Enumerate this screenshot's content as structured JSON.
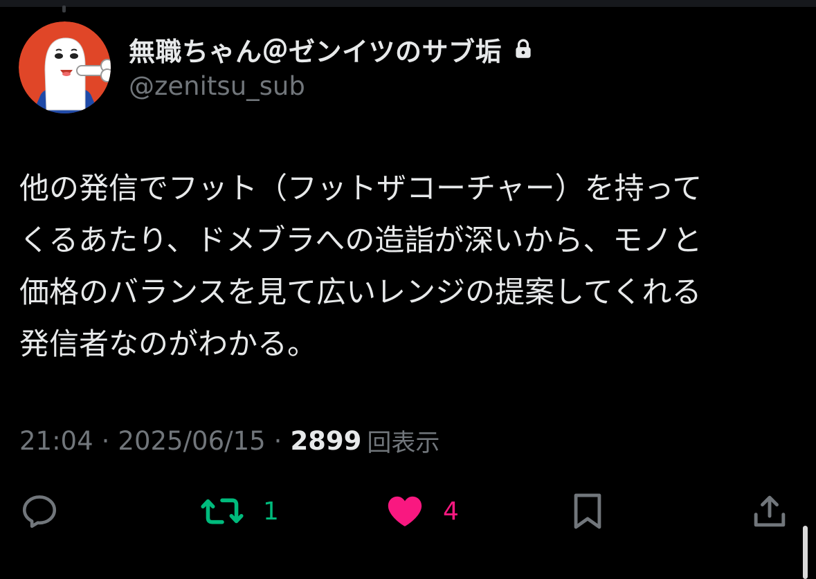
{
  "header": {
    "display_name": "無職ちゃん＠ゼンイツのサブ垢",
    "handle": "@zenitsu_sub",
    "protected_icon": "lock-icon",
    "avatar_bg": "#e04628"
  },
  "tweet": {
    "text": "他の発信でフット（フットザコーチャー）を持って\nくるあたり、ドメブラへの造詣が深いから、モノと\n価格のバランスを見て広いレンジの提案してくれる\n発信者なのがわかる。",
    "time": "21:04",
    "date": "2025/06/15",
    "separator": "·",
    "views_count": "2899",
    "views_label": "回表示"
  },
  "actions": {
    "reply": {
      "icon": "reply-bubble-icon"
    },
    "retweet": {
      "icon": "retweet-icon",
      "count": "1",
      "color": "#00ba7c"
    },
    "like": {
      "icon": "heart-filled-icon",
      "count": "4",
      "color": "#f91880"
    },
    "bookmark": {
      "icon": "bookmark-icon"
    },
    "share": {
      "icon": "share-upload-icon"
    }
  },
  "colors": {
    "background": "#000000",
    "text_primary": "#e7e9ea",
    "text_secondary": "#71767b",
    "icon_default": "#71767b"
  }
}
